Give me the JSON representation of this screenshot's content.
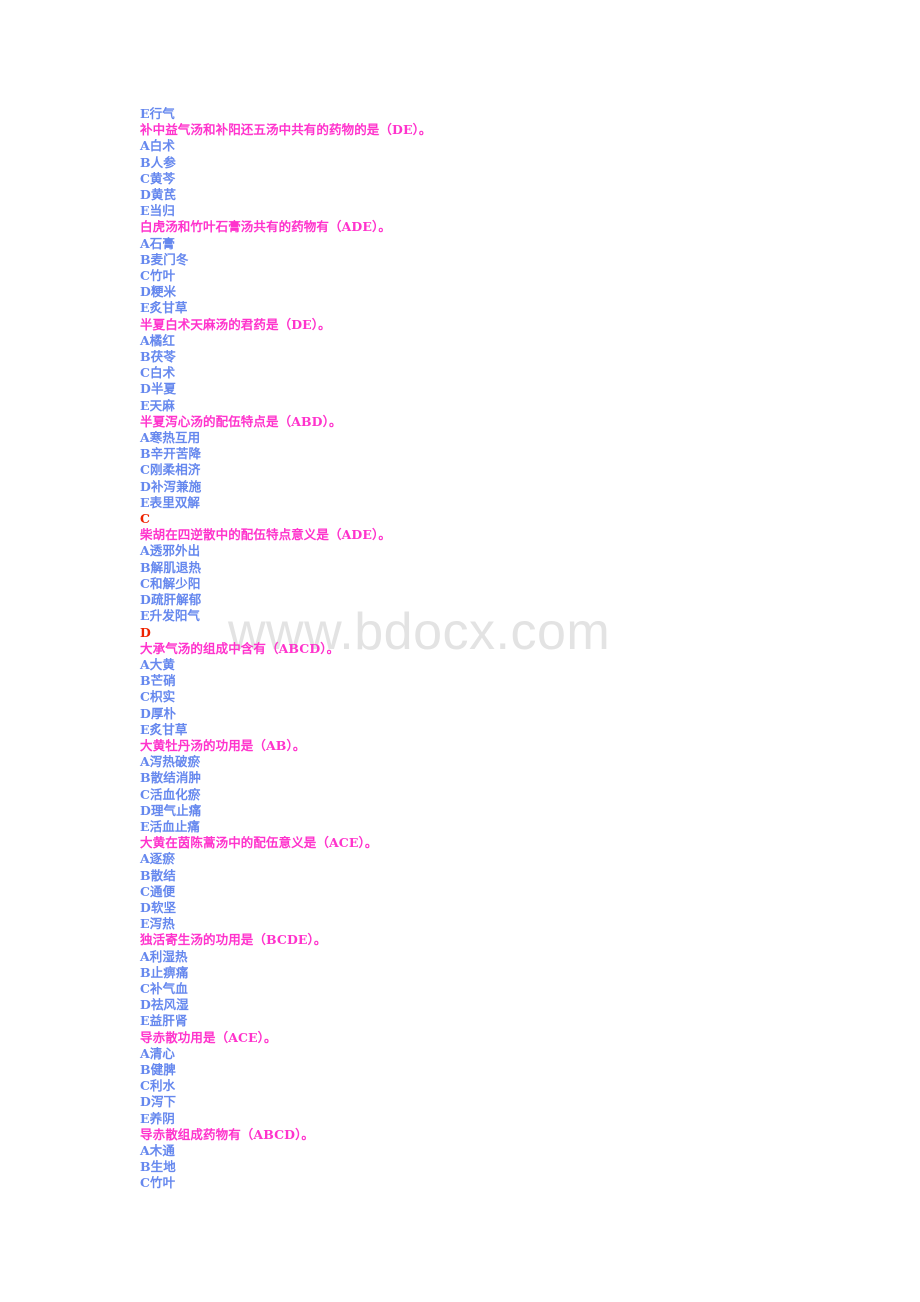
{
  "document": {
    "watermark": "www.bdocx.com",
    "colors": {
      "question": "#ff33cc",
      "option": "#6688ee",
      "answer": "#ee2200",
      "watermark": "#e3e3e3",
      "page_background": "#ffffff"
    },
    "lines": [
      {
        "kind": "opt",
        "text": "E行气"
      },
      {
        "kind": "q",
        "text": "补中益气汤和补阳还五汤中共有的药物的是（DE）。"
      },
      {
        "kind": "opt",
        "text": "A白术"
      },
      {
        "kind": "opt",
        "text": "B人参"
      },
      {
        "kind": "opt",
        "text": "C黄芩"
      },
      {
        "kind": "opt",
        "text": "D黄芪"
      },
      {
        "kind": "opt",
        "text": "E当归"
      },
      {
        "kind": "q",
        "text": "白虎汤和竹叶石膏汤共有的药物有（ADE）。"
      },
      {
        "kind": "opt",
        "text": "A石膏"
      },
      {
        "kind": "opt",
        "text": "B麦门冬"
      },
      {
        "kind": "opt",
        "text": "C竹叶"
      },
      {
        "kind": "opt",
        "text": "D粳米"
      },
      {
        "kind": "opt",
        "text": "E炙甘草"
      },
      {
        "kind": "q",
        "text": "半夏白术天麻汤的君药是（DE）。"
      },
      {
        "kind": "opt",
        "text": "A橘红"
      },
      {
        "kind": "opt",
        "text": "B茯苓"
      },
      {
        "kind": "opt",
        "text": "C白术"
      },
      {
        "kind": "opt",
        "text": "D半夏"
      },
      {
        "kind": "opt",
        "text": "E天麻"
      },
      {
        "kind": "q",
        "text": "半夏泻心汤的配伍特点是（ABD）。"
      },
      {
        "kind": "opt",
        "text": "A寒热互用"
      },
      {
        "kind": "opt",
        "text": "B辛开苦降"
      },
      {
        "kind": "opt",
        "text": "C刚柔相济"
      },
      {
        "kind": "opt",
        "text": "D补泻兼施"
      },
      {
        "kind": "opt",
        "text": "E表里双解"
      },
      {
        "kind": "ans",
        "text": "C"
      },
      {
        "kind": "q",
        "text": "柴胡在四逆散中的配伍特点意义是（ADE）。"
      },
      {
        "kind": "opt",
        "text": "A透邪外出"
      },
      {
        "kind": "opt",
        "text": "B解肌退热"
      },
      {
        "kind": "opt",
        "text": "C和解少阳"
      },
      {
        "kind": "opt",
        "text": "D疏肝解郁"
      },
      {
        "kind": "opt",
        "text": "E升发阳气"
      },
      {
        "kind": "ans",
        "text": "D"
      },
      {
        "kind": "q",
        "text": "大承气汤的组成中含有（ABCD）。"
      },
      {
        "kind": "opt",
        "text": "A大黄"
      },
      {
        "kind": "opt",
        "text": "B芒硝"
      },
      {
        "kind": "opt",
        "text": "C枳实"
      },
      {
        "kind": "opt",
        "text": "D厚朴"
      },
      {
        "kind": "opt",
        "text": "E炙甘草"
      },
      {
        "kind": "q",
        "text": "大黄牡丹汤的功用是（AB）。"
      },
      {
        "kind": "opt",
        "text": "A泻热破瘀"
      },
      {
        "kind": "opt",
        "text": "B散结消肿"
      },
      {
        "kind": "opt",
        "text": "C活血化瘀"
      },
      {
        "kind": "opt",
        "text": "D理气止痛"
      },
      {
        "kind": "opt",
        "text": "E活血止痛"
      },
      {
        "kind": "q",
        "text": "大黄在茵陈蒿汤中的配伍意义是（ACE）。"
      },
      {
        "kind": "opt",
        "text": "A逐瘀"
      },
      {
        "kind": "opt",
        "text": "B散结"
      },
      {
        "kind": "opt",
        "text": "C通便"
      },
      {
        "kind": "opt",
        "text": "D软坚"
      },
      {
        "kind": "opt",
        "text": "E泻热"
      },
      {
        "kind": "q",
        "text": "独活寄生汤的功用是（BCDE）。"
      },
      {
        "kind": "opt",
        "text": "A利湿热"
      },
      {
        "kind": "opt",
        "text": "B止痹痛"
      },
      {
        "kind": "opt",
        "text": "C补气血"
      },
      {
        "kind": "opt",
        "text": "D祛风湿"
      },
      {
        "kind": "opt",
        "text": "E益肝肾"
      },
      {
        "kind": "q",
        "text": "导赤散功用是（ACE）。"
      },
      {
        "kind": "opt",
        "text": "A清心"
      },
      {
        "kind": "opt",
        "text": "B健脾"
      },
      {
        "kind": "opt",
        "text": "C利水"
      },
      {
        "kind": "opt",
        "text": "D泻下"
      },
      {
        "kind": "opt",
        "text": "E养阴"
      },
      {
        "kind": "q",
        "text": "导赤散组成药物有（ABCD）。"
      },
      {
        "kind": "opt",
        "text": "A木通"
      },
      {
        "kind": "opt",
        "text": "B生地"
      },
      {
        "kind": "opt",
        "text": "C竹叶"
      }
    ]
  }
}
